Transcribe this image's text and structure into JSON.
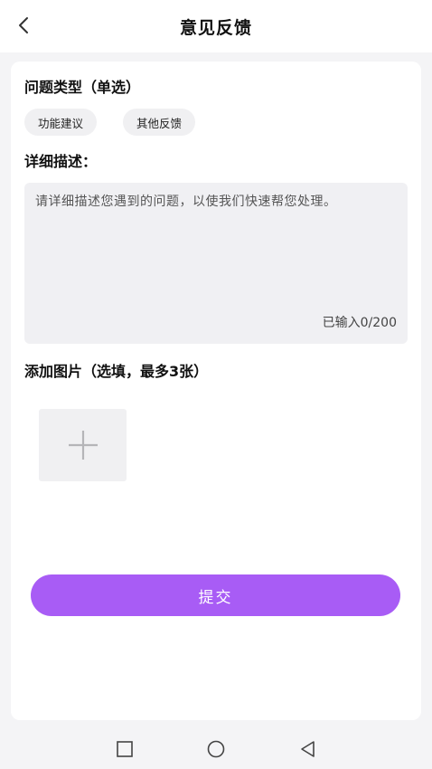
{
  "header": {
    "title": "意见反馈",
    "back_icon": "chevron-left-icon"
  },
  "issue_type": {
    "title": "问题类型（单选）",
    "options": [
      "功能建议",
      "其他反馈"
    ]
  },
  "description": {
    "title": "详细描述：",
    "placeholder": "请详细描述您遇到的问题，以使我们快速帮您处理。",
    "counter": "已输入0/200"
  },
  "images": {
    "title": "添加图片（选填，最多3张）",
    "add_icon": "plus-icon"
  },
  "submit": {
    "label": "提交",
    "color": "#a85cf5"
  },
  "system_nav": {
    "buttons": [
      "square-icon",
      "circle-icon",
      "triangle-back-icon"
    ]
  }
}
